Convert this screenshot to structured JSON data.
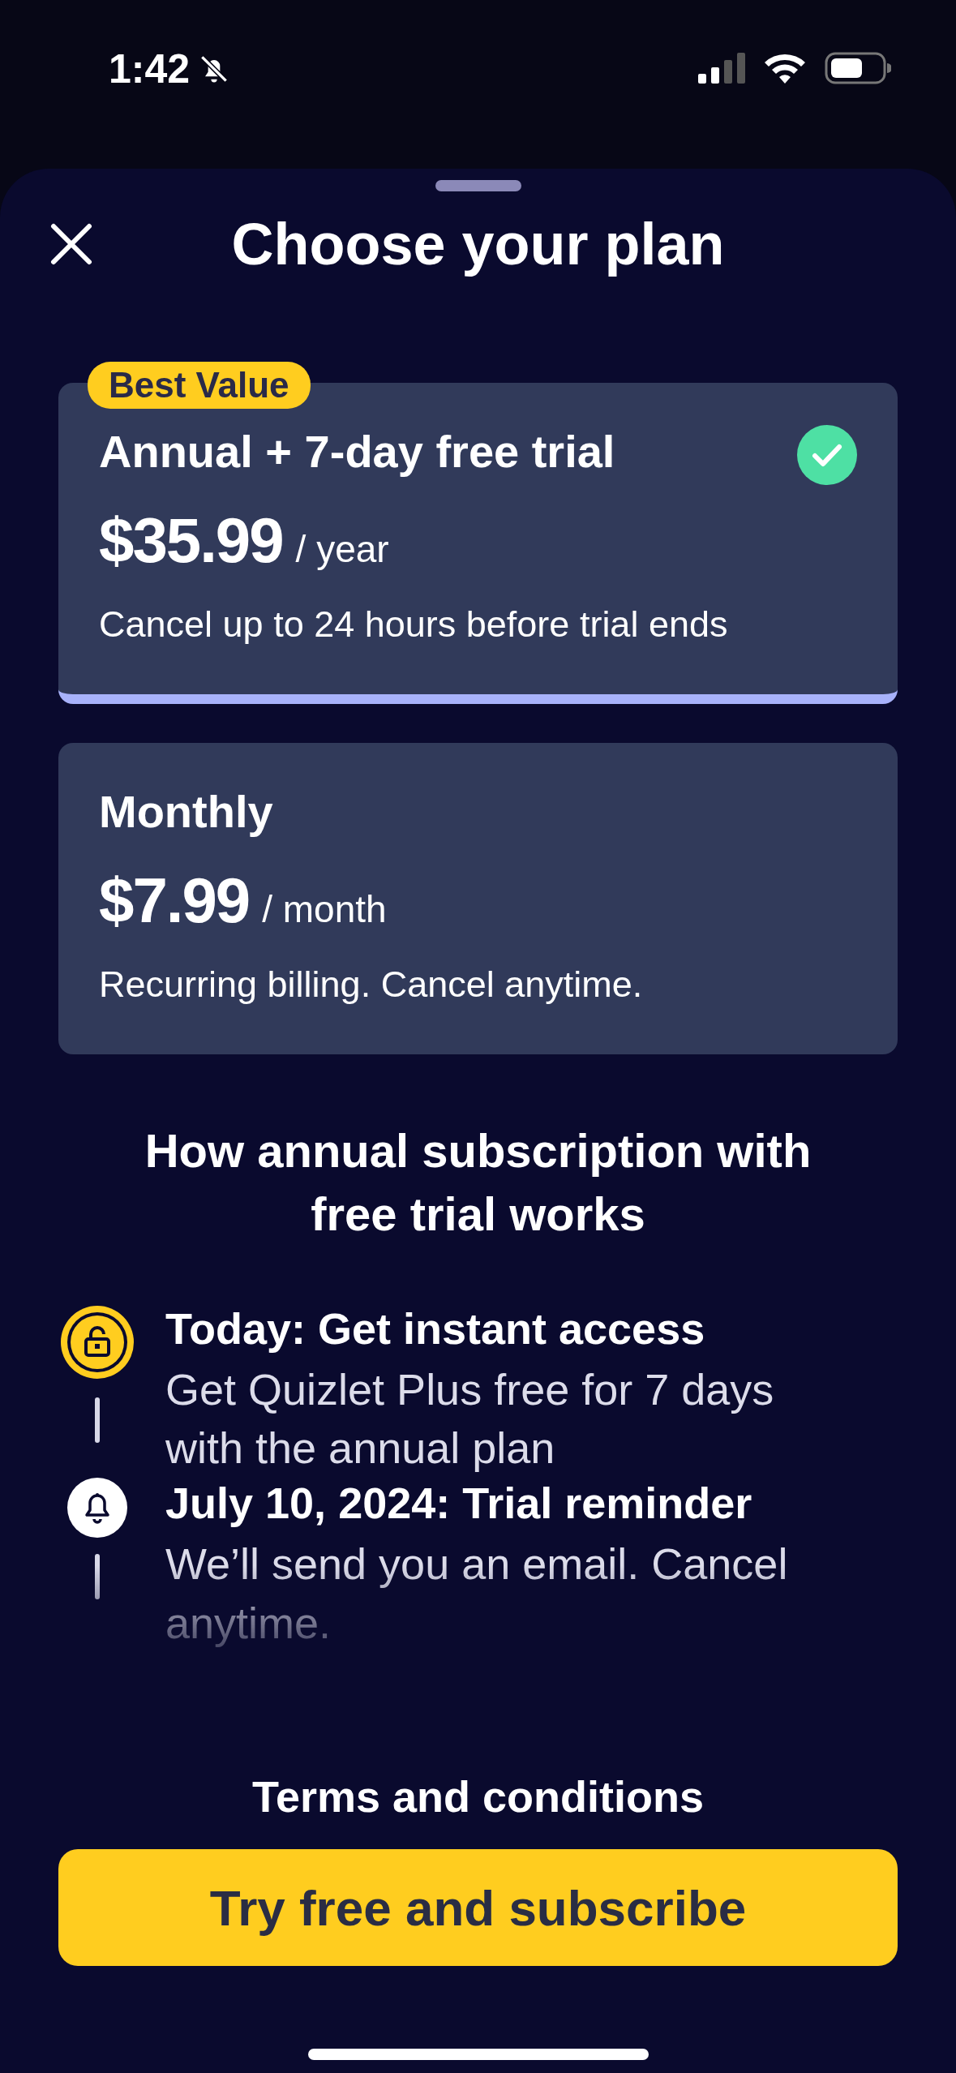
{
  "status_bar": {
    "time": "1:42"
  },
  "sheet": {
    "title": "Choose your plan"
  },
  "plans": [
    {
      "badge": "Best Value",
      "name": "Annual + 7-day free trial",
      "price": "$35.99",
      "period": "/ year",
      "note": "Cancel up to 24 hours before trial ends",
      "selected": true
    },
    {
      "name": "Monthly",
      "price": "$7.99",
      "period": "/ month",
      "note": "Recurring billing. Cancel anytime.",
      "selected": false
    }
  ],
  "explainer": {
    "heading": "How annual subscription with free trial works",
    "steps": [
      {
        "kind": "lock",
        "title": "Today: Get instant access",
        "text": "Get Quizlet Plus free for 7 days with the annual plan"
      },
      {
        "kind": "bell",
        "title": "July 10, 2024: Trial reminder",
        "text": "We’ll send you an email. Cancel anytime."
      }
    ]
  },
  "terms_link": "Terms and conditions",
  "cta_button": "Try free and subscribe"
}
